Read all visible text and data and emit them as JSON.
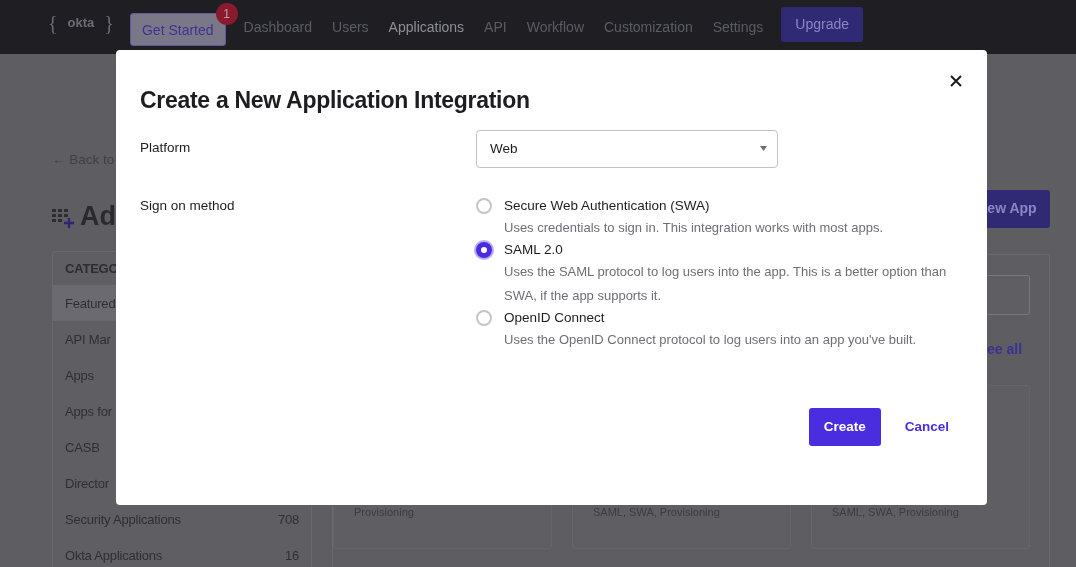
{
  "nav": {
    "logo": {
      "open_brace": "{",
      "text": "okta",
      "close_brace": "}"
    },
    "get_started": {
      "label": "Get Started",
      "badge": "1"
    },
    "links": [
      {
        "label": "Dashboard",
        "selected": false
      },
      {
        "label": "Users",
        "selected": false
      },
      {
        "label": "Applications",
        "selected": true
      },
      {
        "label": "API",
        "selected": false
      },
      {
        "label": "Workflow",
        "selected": false
      },
      {
        "label": "Customization",
        "selected": false
      },
      {
        "label": "Settings",
        "selected": false
      }
    ],
    "upgrade": "Upgrade"
  },
  "page": {
    "back_link": "← Back to",
    "heading": "Ad",
    "new_app_button": "ew App",
    "categories": {
      "header": "CATEGO",
      "items": [
        {
          "label": "Featured",
          "selected": true
        },
        {
          "label": "API Mar",
          "selected": false
        },
        {
          "label": "Apps",
          "selected": false
        },
        {
          "label": "Apps for",
          "selected": false
        },
        {
          "label": "CASB",
          "selected": false
        },
        {
          "label": "Director",
          "selected": false
        },
        {
          "label": "Security Applications",
          "count": "708",
          "selected": false
        },
        {
          "label": "Okta Applications",
          "count": "16",
          "selected": false
        }
      ]
    },
    "see_all": "ee all",
    "cards": [
      {
        "tags": "Provisioning"
      },
      {
        "tags": "SAML, SWA, Provisioning"
      },
      {
        "tags": "SAML, SWA, Provisioning"
      }
    ]
  },
  "modal": {
    "title": "Create a New Application Integration",
    "platform": {
      "label": "Platform",
      "value": "Web"
    },
    "sign_on": {
      "label": "Sign on method",
      "options": [
        {
          "label": "Secure Web Authentication (SWA)",
          "description": "Uses credentials to sign in. This integration works with most apps.",
          "selected": false
        },
        {
          "label": "SAML 2.0",
          "description": "Uses the SAML protocol to log users into the app. This is a better option than SWA, if the app supports it.",
          "selected": true
        },
        {
          "label": "OpenID Connect",
          "description": "Uses the OpenID Connect protocol to log users into an app you've built.",
          "selected": false
        }
      ]
    },
    "buttons": {
      "primary": "Create",
      "secondary": "Cancel"
    }
  }
}
